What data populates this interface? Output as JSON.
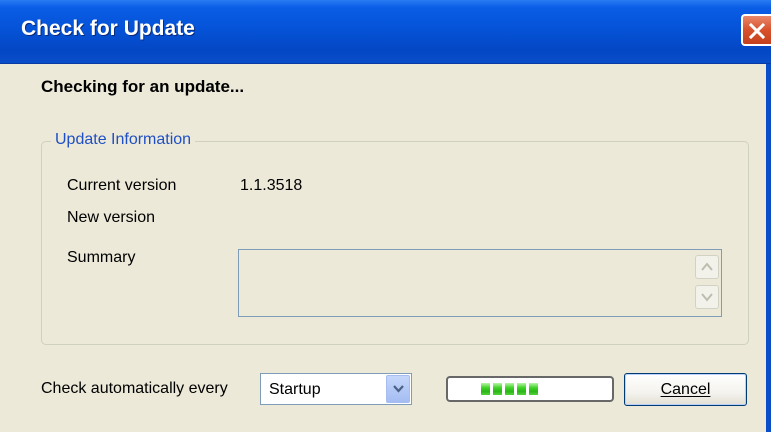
{
  "window": {
    "title": "Check for Update",
    "close_icon": "close-icon",
    "accent_color": "#0553d8"
  },
  "heading": "Checking for an update...",
  "update_info": {
    "group_label": "Update Information",
    "current_version_label": "Current version",
    "current_version_value": "1.1.3518",
    "new_version_label": "New version",
    "new_version_value": "",
    "summary_label": "Summary",
    "summary_value": ""
  },
  "footer": {
    "auto_check_label": "Check automatically every",
    "auto_check_selected": "Startup",
    "progress_segments": 5,
    "progress_color": "#2bb517",
    "cancel_label": "Cancel"
  }
}
